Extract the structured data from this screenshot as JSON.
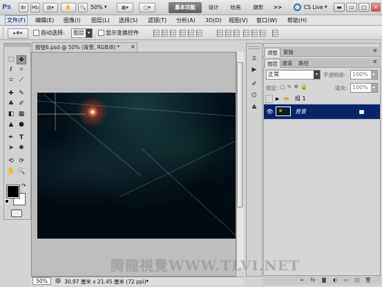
{
  "appbar": {
    "logo": "Ps",
    "app_buttons": [
      "Br",
      "Mb"
    ],
    "zoom": "50%",
    "workspaces": [
      "基本功能",
      "设计",
      "绘画",
      "摄影"
    ],
    "more": ">>",
    "cslive": "CS Live"
  },
  "menu": [
    "文件(F)",
    "编辑(E)",
    "图像(I)",
    "图层(L)",
    "选择(S)",
    "滤镜(T)",
    "分析(A)",
    "3D(D)",
    "视图(V)",
    "窗口(W)",
    "帮助(H)"
  ],
  "options": {
    "auto_select_label": "自动选择:",
    "auto_select_value": "图层",
    "show_transform_label": "显示变换控件"
  },
  "document": {
    "tab_title": "按钮6.psd @ 50% (背景, RGB/8) *",
    "zoom": "50%",
    "status": "30.97 厘米 x 21.45 厘米 (72 ppi)"
  },
  "panels": {
    "top_tabs": [
      "调整",
      "蒙版"
    ],
    "layer_tabs": [
      "图层",
      "通道",
      "路径"
    ],
    "blend_mode": "正常",
    "opacity_label": "不透明度:",
    "opacity_value": "100%",
    "lock_label": "锁定:",
    "fill_label": "填充:",
    "fill_value": "100%",
    "layers": [
      {
        "name": "组 1",
        "type": "group",
        "visible": false
      },
      {
        "name": "背景",
        "type": "layer",
        "visible": true,
        "selected": true
      }
    ]
  },
  "watermark": "腾龍視覺WWW.TLVI.NET",
  "colors": {
    "selected_layer": "#0a246a",
    "workspace_active": "#6e6e6e"
  }
}
